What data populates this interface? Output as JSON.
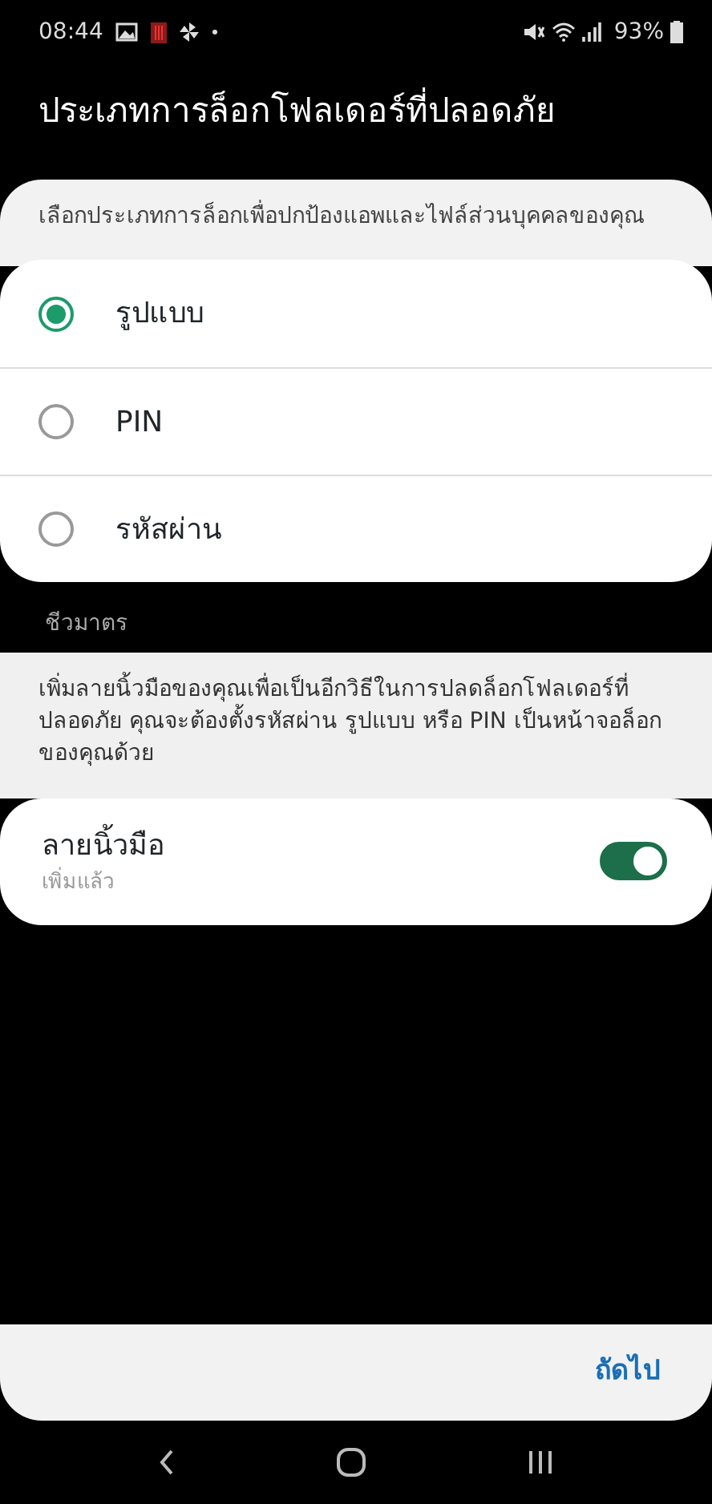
{
  "status_bar": {
    "time": "08:44",
    "battery": "93%"
  },
  "title": "ประเภทการล็อกโฟลเดอร์ที่ปลอดภัย",
  "lock_types": {
    "description": "เลือกประเภทการล็อกเพื่อปกป้องแอพและไฟล์ส่วนบุคคลของคุณ",
    "options": [
      {
        "label": "รูปแบบ",
        "selected": true
      },
      {
        "label": "PIN",
        "selected": false
      },
      {
        "label": "รหัสผ่าน",
        "selected": false
      }
    ]
  },
  "biometrics": {
    "header": "ชีวมาตร",
    "description": "เพิ่มลายนิ้วมือของคุณเพื่อเป็นอีกวิธีในการปลดล็อกโฟลเดอร์ที่ปลอดภัย คุณจะต้องตั้งรหัสผ่าน รูปแบบ หรือ PIN เป็นหน้าจอล็อกของคุณด้วย",
    "items": [
      {
        "title": "ลายนิ้วมือ",
        "subtitle": "เพิ่มแล้ว",
        "on": true
      }
    ]
  },
  "footer": {
    "next_button": "ถัดไป"
  }
}
